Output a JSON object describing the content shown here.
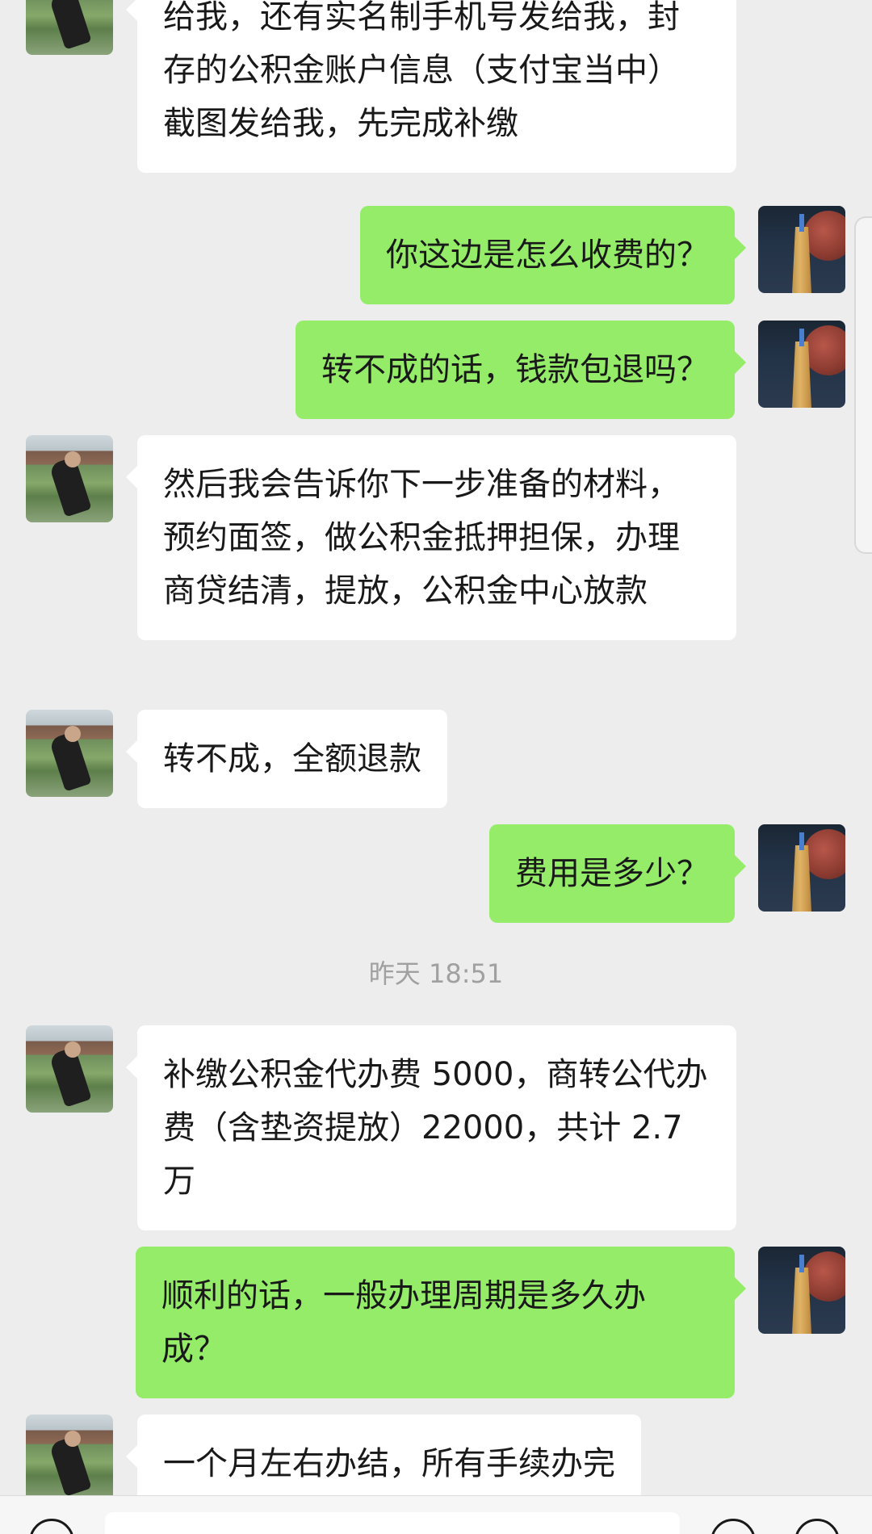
{
  "messages": [
    {
      "side": "left",
      "text": "给我，还有实名制手机号发给我，封存的公积金账户信息（支付宝当中）截图发给我，先完成补缴"
    },
    {
      "side": "right",
      "text": "你这边是怎么收费的？"
    },
    {
      "side": "right",
      "text": "转不成的话，钱款包退吗？"
    },
    {
      "side": "left",
      "text": "然后我会告诉你下一步准备的材料，预约面签，做公积金抵押担保，办理商贷结清，提放，公积金中心放款"
    },
    {
      "side": "left",
      "text": "转不成，全额退款"
    },
    {
      "side": "right",
      "text": "费用是多少？"
    },
    {
      "side": "left",
      "text": "补缴公积金代办费 5000，商转公代办费（含垫资提放）22000，共计 2.7 万"
    },
    {
      "side": "right",
      "text": "顺利的话，一般办理周期是多久办成？"
    },
    {
      "side": "left",
      "text": "一个月左右办结，所有手续办完"
    }
  ],
  "timestamp": "昨天 18:51",
  "colors": {
    "sent_bubble": "#95ec69",
    "received_bubble": "#ffffff",
    "background": "#ededed"
  }
}
